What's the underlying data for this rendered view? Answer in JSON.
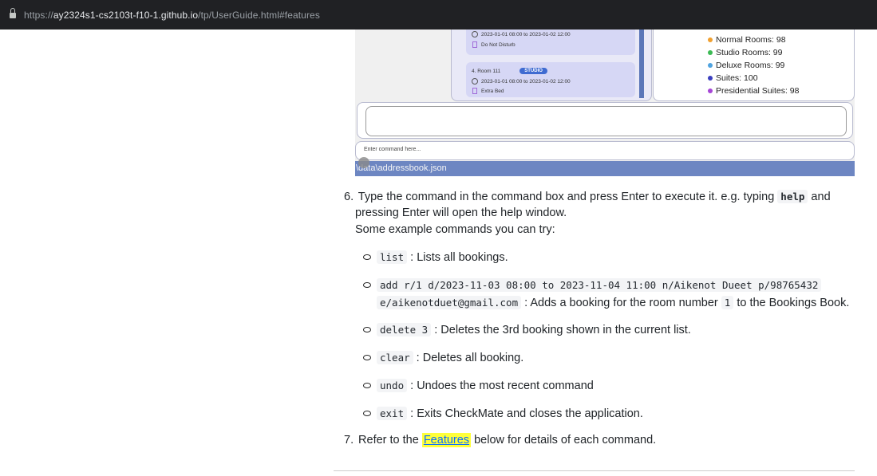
{
  "browser": {
    "url_scheme": "https://",
    "url_host": "ay2324s1-cs2103t-f10-1.github.io",
    "url_path": "/tp/UserGuide.html#features"
  },
  "app": {
    "card1": {
      "line1": "2023-01-01 08:00 to 2023-01-02 12:00",
      "line2": "Do Not Disturb"
    },
    "card2": {
      "title": "4.  Room 111",
      "tag": "STUDIO",
      "line1": "2023-01-01 08:00 to 2023-01-02 12:00",
      "line2": "Extra Bed"
    },
    "stats": [
      {
        "label": "Normal Rooms: 98",
        "color": "#f0a030"
      },
      {
        "label": "Studio Rooms: 99",
        "color": "#3cba54"
      },
      {
        "label": "Deluxe Rooms: 99",
        "color": "#4fa3e0"
      },
      {
        "label": "Suites: 100",
        "color": "#3b3fbf"
      },
      {
        "label": "Presidential Suites: 98",
        "color": "#a646d6"
      }
    ],
    "command_placeholder": "Enter command here...",
    "status_path": "\\data\\addressbook.json"
  },
  "doc": {
    "step6": {
      "num": "6.",
      "text_a": "Type the command in the command box and press Enter to execute it. e.g. typing ",
      "code": "help",
      "text_b": " and",
      "line2": "pressing Enter will open the help window.",
      "line3": "Some example commands you can try:"
    },
    "commands": [
      {
        "code": "list",
        "desc": " : Lists all bookings."
      },
      {
        "code": "add r/1 d/2023-11-03 08:00 to 2023-11-04 11:00 n/Aikenot Dueet p/98765432",
        "code2": "e/aikenotduet@gmail.com",
        "desc_a": " : Adds a booking for the room number ",
        "code3": "1",
        "desc_b": " to the Bookings Book."
      },
      {
        "code": "delete 3",
        "desc": " : Deletes the 3rd booking shown in the current list."
      },
      {
        "code": "clear",
        "desc": " : Deletes all booking."
      },
      {
        "code": "undo",
        "desc": " : Undoes the most recent command"
      },
      {
        "code": "exit",
        "desc": " : Exits CheckMate and closes the application."
      }
    ],
    "step7": {
      "num": "7.",
      "text_a": "Refer to the ",
      "link": "Features",
      "text_b": " below for details of each command."
    }
  }
}
